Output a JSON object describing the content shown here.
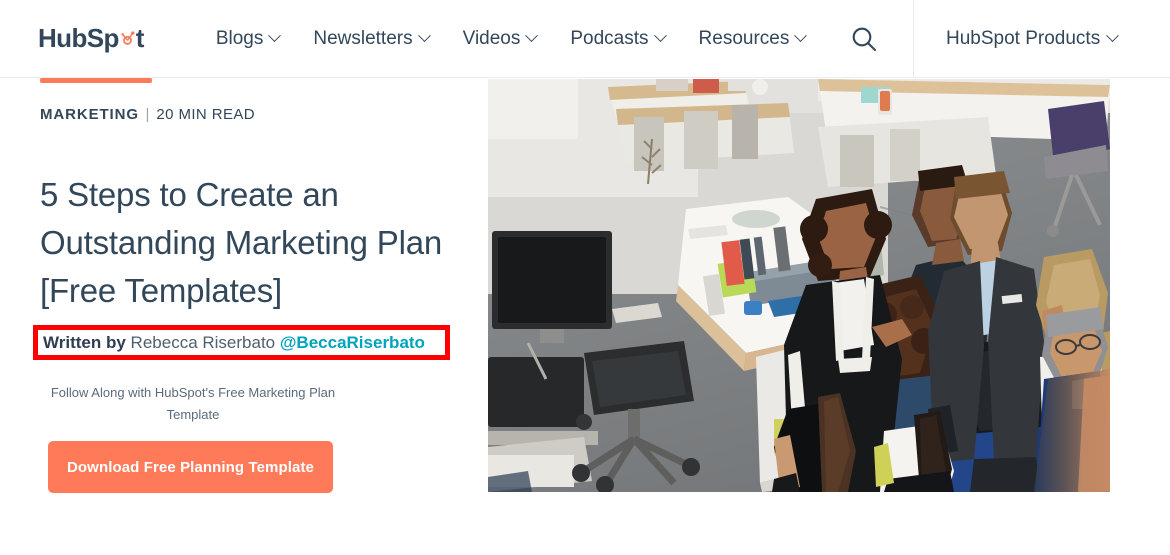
{
  "header": {
    "logo_text_pre": "HubSp",
    "logo_text_post": "t",
    "logo_name": "HubSpot",
    "nav_items": [
      {
        "label": "Blogs",
        "has_chevron": true
      },
      {
        "label": "Newsletters",
        "has_chevron": true
      },
      {
        "label": "Videos",
        "has_chevron": true
      },
      {
        "label": "Podcasts",
        "has_chevron": true
      },
      {
        "label": "Resources",
        "has_chevron": true
      }
    ],
    "search_icon": "search-icon",
    "products": {
      "label": "HubSpot Products",
      "has_chevron": true
    }
  },
  "article": {
    "topic_bar_color": "#ff7a59",
    "category": "MARKETING",
    "separator": "|",
    "read_time": "20 MIN READ",
    "headline": "5 Steps to Create an Outstanding Marketing Plan [Free Templates]",
    "byline": {
      "written_by_label": "Written by",
      "author": "Rebecca Riserbato",
      "handle": "@BeccaRiserbato",
      "highlight_color": "#ff0000",
      "handle_color": "#00a4bd"
    },
    "cta": {
      "subtitle": "Follow Along with HubSpot's Free Marketing Plan Template",
      "button_label": "Download Free Planning Template",
      "button_color": "#ff7a59"
    },
    "hero_image_alt": "Group of business professionals standing and talking in an open office space, viewed from above"
  }
}
